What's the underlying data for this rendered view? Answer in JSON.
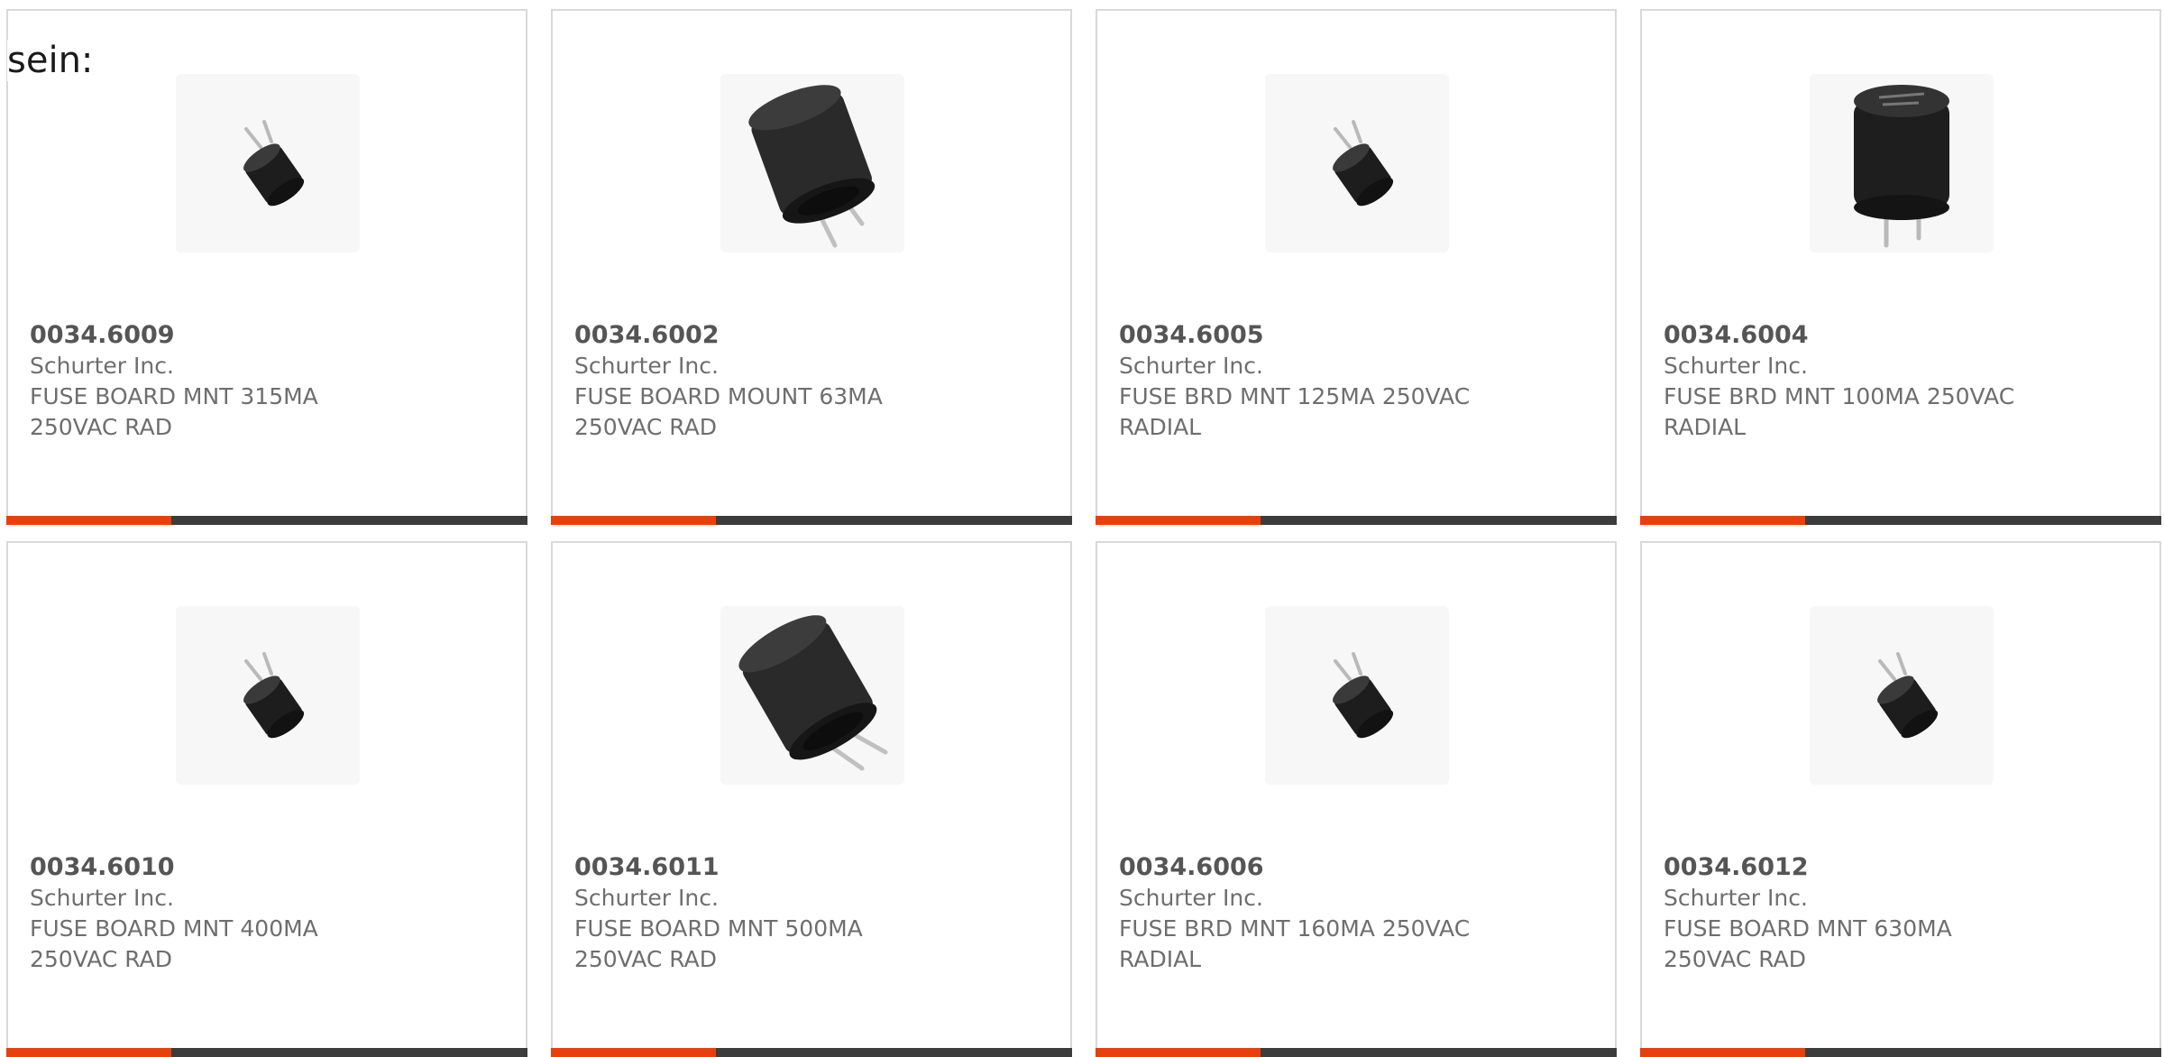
{
  "leading_text": "sein:",
  "colors": {
    "accent": "#e8400c",
    "bar": "#3c3c3c",
    "text": "#6e6e6e",
    "border": "#d9d9d9"
  },
  "products": [
    {
      "part": "0034.6009",
      "maker": "Schurter Inc.",
      "description": "FUSE BOARD MNT 315MA 250VAC RAD",
      "image": "small-fuse-angled-icon"
    },
    {
      "part": "0034.6002",
      "maker": "Schurter Inc.",
      "description": "FUSE BOARD MOUNT 63MA 250VAC RAD",
      "image": "large-fuse-tilted-icon"
    },
    {
      "part": "0034.6005",
      "maker": "Schurter Inc.",
      "description": "FUSE BRD MNT 125MA 250VAC RADIAL",
      "image": "small-fuse-angled-icon"
    },
    {
      "part": "0034.6004",
      "maker": "Schurter Inc.",
      "description": "FUSE BRD MNT 100MA 250VAC RADIAL",
      "image": "fuse-upright-icon"
    },
    {
      "part": "0034.6010",
      "maker": "Schurter Inc.",
      "description": "FUSE BOARD MNT 400MA 250VAC RAD",
      "image": "small-fuse-angled-icon"
    },
    {
      "part": "0034.6011",
      "maker": "Schurter Inc.",
      "description": "FUSE BOARD MNT 500MA 250VAC RAD",
      "image": "large-fuse-tilted-icon"
    },
    {
      "part": "0034.6006",
      "maker": "Schurter Inc.",
      "description": "FUSE BRD MNT 160MA 250VAC RADIAL",
      "image": "small-fuse-angled-icon"
    },
    {
      "part": "0034.6012",
      "maker": "Schurter Inc.",
      "description": "FUSE BOARD MNT 630MA 250VAC RAD",
      "image": "small-fuse-angled-icon"
    }
  ]
}
